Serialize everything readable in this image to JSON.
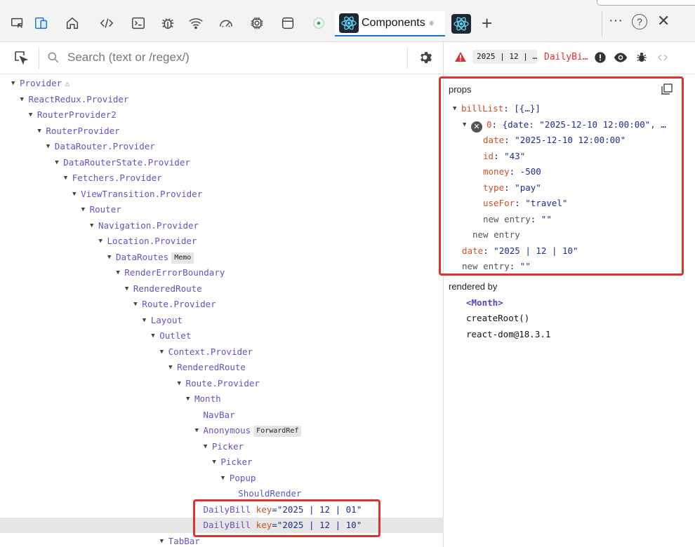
{
  "toolbar": {
    "tools": [
      {
        "name": "device-toggle-icon"
      },
      {
        "name": "device-emulation-icon"
      },
      {
        "name": "home-icon"
      },
      {
        "name": "elements-icon"
      },
      {
        "name": "console-icon"
      },
      {
        "name": "sources-bug-icon"
      },
      {
        "name": "network-wifi-icon"
      },
      {
        "name": "performance-gauge-icon"
      },
      {
        "name": "memory-chip-icon"
      },
      {
        "name": "application-window-icon"
      },
      {
        "name": "lighthouse-circle-icon"
      }
    ],
    "active_tab_label": "Components",
    "active_tab_gear": "⚛",
    "plus": "+",
    "more": "···",
    "help": "?",
    "close": "✕",
    "accent": "#1a73c8"
  },
  "search": {
    "placeholder": "Search (text or /regex/)"
  },
  "tree": [
    {
      "name": "Provider",
      "caret": "▼",
      "warn": "⚠"
    },
    {
      "name": "ReactRedux.Provider",
      "caret": "▼"
    },
    {
      "name": "RouterProvider2",
      "caret": "▼"
    },
    {
      "name": "RouterProvider",
      "caret": "▼"
    },
    {
      "name": "DataRouter.Provider",
      "caret": "▼"
    },
    {
      "name": "DataRouterState.Provider",
      "caret": "▼"
    },
    {
      "name": "Fetchers.Provider",
      "caret": "▼"
    },
    {
      "name": "ViewTransition.Provider",
      "caret": "▼"
    },
    {
      "name": "Router",
      "caret": "▼"
    },
    {
      "name": "Navigation.Provider",
      "caret": "▼"
    },
    {
      "name": "Location.Provider",
      "caret": "▼"
    },
    {
      "name": "DataRoutes",
      "caret": "▼",
      "badge": "Memo"
    },
    {
      "name": "RenderErrorBoundary",
      "caret": "▼"
    },
    {
      "name": "RenderedRoute",
      "caret": "▼"
    },
    {
      "name": "Route.Provider",
      "caret": "▼"
    },
    {
      "name": "Layout",
      "caret": "▼"
    },
    {
      "name": "Outlet",
      "caret": "▼"
    },
    {
      "name": "Context.Provider",
      "caret": "▼"
    },
    {
      "name": "RenderedRoute",
      "caret": "▼"
    },
    {
      "name": "Route.Provider",
      "caret": "▼"
    },
    {
      "name": "Month",
      "caret": "▼"
    },
    {
      "name": "NavBar",
      "caret": ""
    },
    {
      "name": "Anonymous",
      "caret": "▼",
      "badge": "ForwardRef"
    },
    {
      "name": "Picker",
      "caret": "▼"
    },
    {
      "name": "Picker",
      "caret": "▼"
    },
    {
      "name": "Popup",
      "caret": "▼"
    },
    {
      "name": "ShouldRender",
      "caret": ""
    },
    {
      "name": "DailyBill",
      "caret": "",
      "key_label": "key",
      "key_value": "=\"2025 | 12 | 01\""
    },
    {
      "name": "DailyBill",
      "caret": "",
      "key_label": "key",
      "key_value": "=\"2025 | 12 | 10\"",
      "selected": true
    },
    {
      "name": "TabBar",
      "caret": "▼"
    }
  ],
  "selected": {
    "warning_icon": "warning-triangle-icon",
    "crumb": "2025 | 12 | …",
    "title": "DailyBi…"
  },
  "props": {
    "title": "props",
    "rows": [
      {
        "caret": "▼",
        "key": "billList",
        "value": "[{…}]"
      },
      {
        "caret": "▼",
        "x": "✕",
        "key": "0",
        "value": "{date: \"2025-12-10 12:00:00\", …"
      },
      {
        "key": "date",
        "value": "\"2025-12-10 12:00:00\""
      },
      {
        "key": "id",
        "value": "\"43\""
      },
      {
        "key": "money",
        "value": "-500"
      },
      {
        "key": "type",
        "value": "\"pay\""
      },
      {
        "key": "useFor",
        "value": "\"travel\""
      },
      {
        "new_key": "new entry",
        "value": "\"\""
      },
      {
        "new_key": "new entry"
      },
      {
        "key": "date",
        "value": "\"2025 | 12 | 10\""
      },
      {
        "new_key": "new entry",
        "value": "\"\""
      }
    ]
  },
  "rendered_by": {
    "title": "rendered by",
    "items": [
      "<Month>",
      "createRoot()",
      "react-dom@18.3.1"
    ]
  },
  "colors": {
    "component": "#6a4fc0",
    "prop_key": "#c8522a",
    "prop_value": "#1b2e8c",
    "highlight": "#e0312e",
    "selected_row": "#e6e6e6"
  }
}
